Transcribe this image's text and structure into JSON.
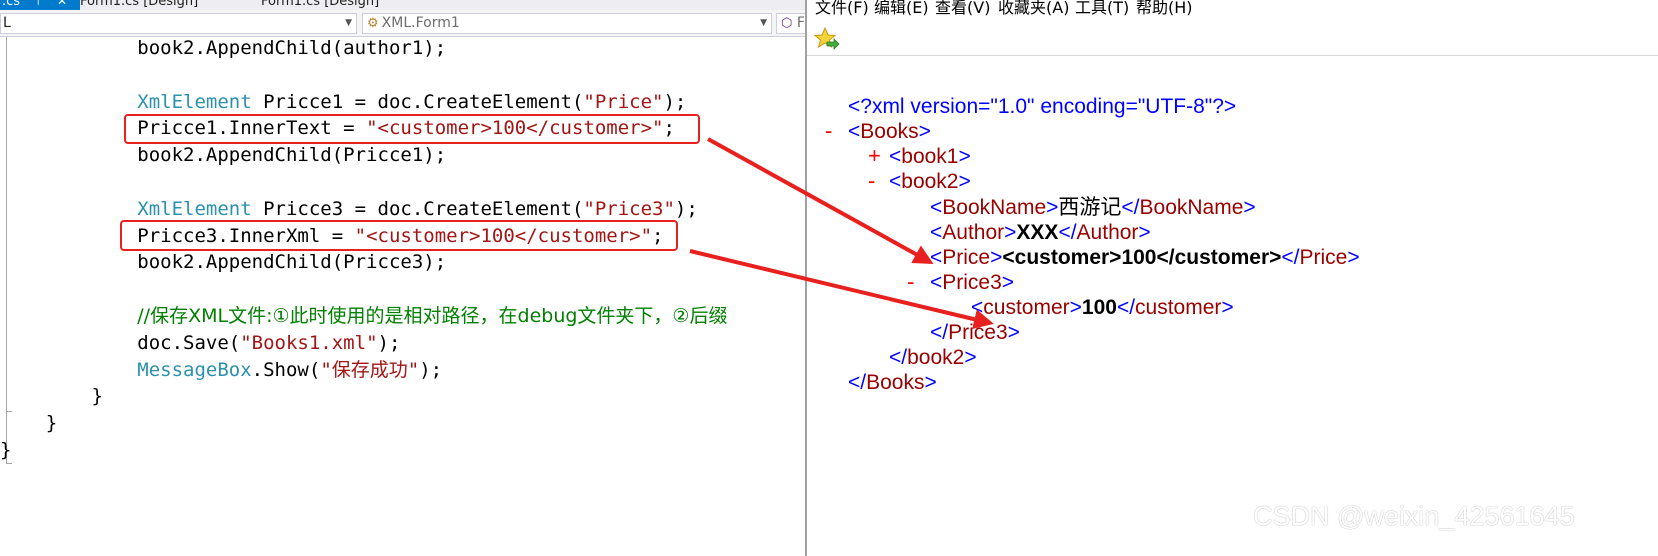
{
  "vs": {
    "tabs": [
      {
        "label": ".cs",
        "pin": "⊤",
        "close": "✕"
      },
      {
        "label": "Form1.cs [Design]"
      },
      {
        "label": "Form1.cs [Design]"
      }
    ],
    "nav": {
      "left_value": "L",
      "mid_value": "XML.Form1",
      "right_value": "F"
    },
    "code_lines": [
      {
        "indent": "            ",
        "parts": [
          {
            "t": "book2.AppendChild(author1);",
            "c": ""
          }
        ]
      },
      {
        "indent": "",
        "parts": []
      },
      {
        "indent": "            ",
        "parts": [
          {
            "t": "XmlElement",
            "c": "kw"
          },
          {
            "t": " Pricce1 = doc.CreateElement(",
            "c": ""
          },
          {
            "t": "\"Price\"",
            "c": "str"
          },
          {
            "t": ");",
            "c": ""
          }
        ]
      },
      {
        "indent": "            ",
        "parts": [
          {
            "t": "Pricce1.InnerText = ",
            "c": ""
          },
          {
            "t": "\"<customer>100</customer>\"",
            "c": "str"
          },
          {
            "t": ";",
            "c": ""
          }
        ]
      },
      {
        "indent": "            ",
        "parts": [
          {
            "t": "book2.AppendChild(Pricce1);",
            "c": ""
          }
        ]
      },
      {
        "indent": "",
        "parts": []
      },
      {
        "indent": "            ",
        "parts": [
          {
            "t": "XmlElement",
            "c": "kw"
          },
          {
            "t": " Pricce3 = doc.CreateElement(",
            "c": ""
          },
          {
            "t": "\"Price3\"",
            "c": "str"
          },
          {
            "t": ");",
            "c": ""
          }
        ]
      },
      {
        "indent": "            ",
        "parts": [
          {
            "t": "Pricce3.InnerXml = ",
            "c": ""
          },
          {
            "t": "\"<customer>100</customer>\"",
            "c": "str"
          },
          {
            "t": ";",
            "c": ""
          }
        ]
      },
      {
        "indent": "            ",
        "parts": [
          {
            "t": "book2.AppendChild(Pricce3);",
            "c": ""
          }
        ]
      },
      {
        "indent": "",
        "parts": []
      },
      {
        "indent": "            ",
        "parts": [
          {
            "t": "//保存XML文件:①此时使用的是相对路径，在debug文件夹下，②后缀",
            "c": "cm cmt"
          }
        ]
      },
      {
        "indent": "            ",
        "parts": [
          {
            "t": "doc.Save(",
            "c": ""
          },
          {
            "t": "\"Books1.xml\"",
            "c": "str"
          },
          {
            "t": ");",
            "c": ""
          }
        ]
      },
      {
        "indent": "            ",
        "parts": [
          {
            "t": "MessageBox",
            "c": "kw"
          },
          {
            "t": ".Show(",
            "c": ""
          },
          {
            "t": "\"保存成功\"",
            "c": "str"
          },
          {
            "t": ");",
            "c": ""
          }
        ]
      },
      {
        "indent": "        ",
        "parts": [
          {
            "t": "}",
            "c": ""
          }
        ]
      },
      {
        "indent": "    ",
        "parts": [
          {
            "t": "}",
            "c": ""
          }
        ]
      },
      {
        "indent": "",
        "parts": [
          {
            "t": "}",
            "c": ""
          }
        ]
      }
    ]
  },
  "ie": {
    "menu": [
      "文件(F)",
      "编辑(E)",
      "查看(V)",
      "收藏夹(A)",
      "工具(T)",
      "帮助(H)"
    ],
    "xml_lines": [
      {
        "toggle": "",
        "parts": [
          {
            "t": "<?xml version=\"1.0\" encoding=\"UTF-8\"?>",
            "c": "blue"
          }
        ]
      },
      {
        "toggle": "-",
        "parts": [
          {
            "t": "<",
            "c": "blue"
          },
          {
            "t": "Books",
            "c": "tagn"
          },
          {
            "t": ">",
            "c": "blue"
          }
        ]
      },
      {
        "toggle": "+",
        "parts": [
          {
            "t": "<",
            "c": "blue"
          },
          {
            "t": "book1",
            "c": "tagn"
          },
          {
            "t": ">",
            "c": "blue"
          }
        ]
      },
      {
        "toggle": "-",
        "parts": [
          {
            "t": "<",
            "c": "blue"
          },
          {
            "t": "book2",
            "c": "tagn"
          },
          {
            "t": ">",
            "c": "blue"
          }
        ]
      },
      {
        "toggle": "",
        "parts": [
          {
            "t": "<",
            "c": "blue"
          },
          {
            "t": "BookName",
            "c": "tagn"
          },
          {
            "t": ">",
            "c": "blue"
          },
          {
            "t": "西游记",
            "c": "txtcn"
          },
          {
            "t": "</",
            "c": "blue"
          },
          {
            "t": "BookName",
            "c": "tagn"
          },
          {
            "t": ">",
            "c": "blue"
          }
        ]
      },
      {
        "toggle": "",
        "parts": [
          {
            "t": "<",
            "c": "blue"
          },
          {
            "t": "Author",
            "c": "tagn"
          },
          {
            "t": ">",
            "c": "blue"
          },
          {
            "t": "XXX",
            "c": "txt"
          },
          {
            "t": "</",
            "c": "blue"
          },
          {
            "t": "Author",
            "c": "tagn"
          },
          {
            "t": ">",
            "c": "blue"
          }
        ]
      },
      {
        "toggle": "",
        "parts": [
          {
            "t": "<",
            "c": "blue"
          },
          {
            "t": "Price",
            "c": "tagn"
          },
          {
            "t": ">",
            "c": "blue"
          },
          {
            "t": "<customer>100</customer>",
            "c": "txt"
          },
          {
            "t": "</",
            "c": "blue"
          },
          {
            "t": "Price",
            "c": "tagn"
          },
          {
            "t": ">",
            "c": "blue"
          }
        ]
      },
      {
        "toggle": "-",
        "parts": [
          {
            "t": "<",
            "c": "blue"
          },
          {
            "t": "Price3",
            "c": "tagn"
          },
          {
            "t": ">",
            "c": "blue"
          }
        ]
      },
      {
        "toggle": "",
        "parts": [
          {
            "t": "<",
            "c": "blue"
          },
          {
            "t": "customer",
            "c": "tagn"
          },
          {
            "t": ">",
            "c": "blue"
          },
          {
            "t": "100",
            "c": "txt"
          },
          {
            "t": "</",
            "c": "blue"
          },
          {
            "t": "customer",
            "c": "tagn"
          },
          {
            "t": ">",
            "c": "blue"
          }
        ]
      },
      {
        "toggle": "",
        "parts": [
          {
            "t": "</",
            "c": "blue"
          },
          {
            "t": "Price3",
            "c": "tagn"
          },
          {
            "t": ">",
            "c": "blue"
          }
        ]
      },
      {
        "toggle": "",
        "parts": [
          {
            "t": "</",
            "c": "blue"
          },
          {
            "t": "book2",
            "c": "tagn"
          },
          {
            "t": ">",
            "c": "blue"
          }
        ]
      },
      {
        "toggle": "",
        "parts": [
          {
            "t": "</",
            "c": "blue"
          },
          {
            "t": "Books",
            "c": "tagn"
          },
          {
            "t": ">",
            "c": "blue"
          }
        ]
      }
    ]
  },
  "watermark": "CSDN @weixin_42561645",
  "colors": {
    "highlight_box": "#e8201e",
    "arrow": "#e8201e",
    "keyword": "#2b91af",
    "string": "#a31515",
    "comment": "#008000",
    "xml_markup": "#0000ff",
    "xml_tag": "#990000",
    "toggle": "#ff0000"
  }
}
